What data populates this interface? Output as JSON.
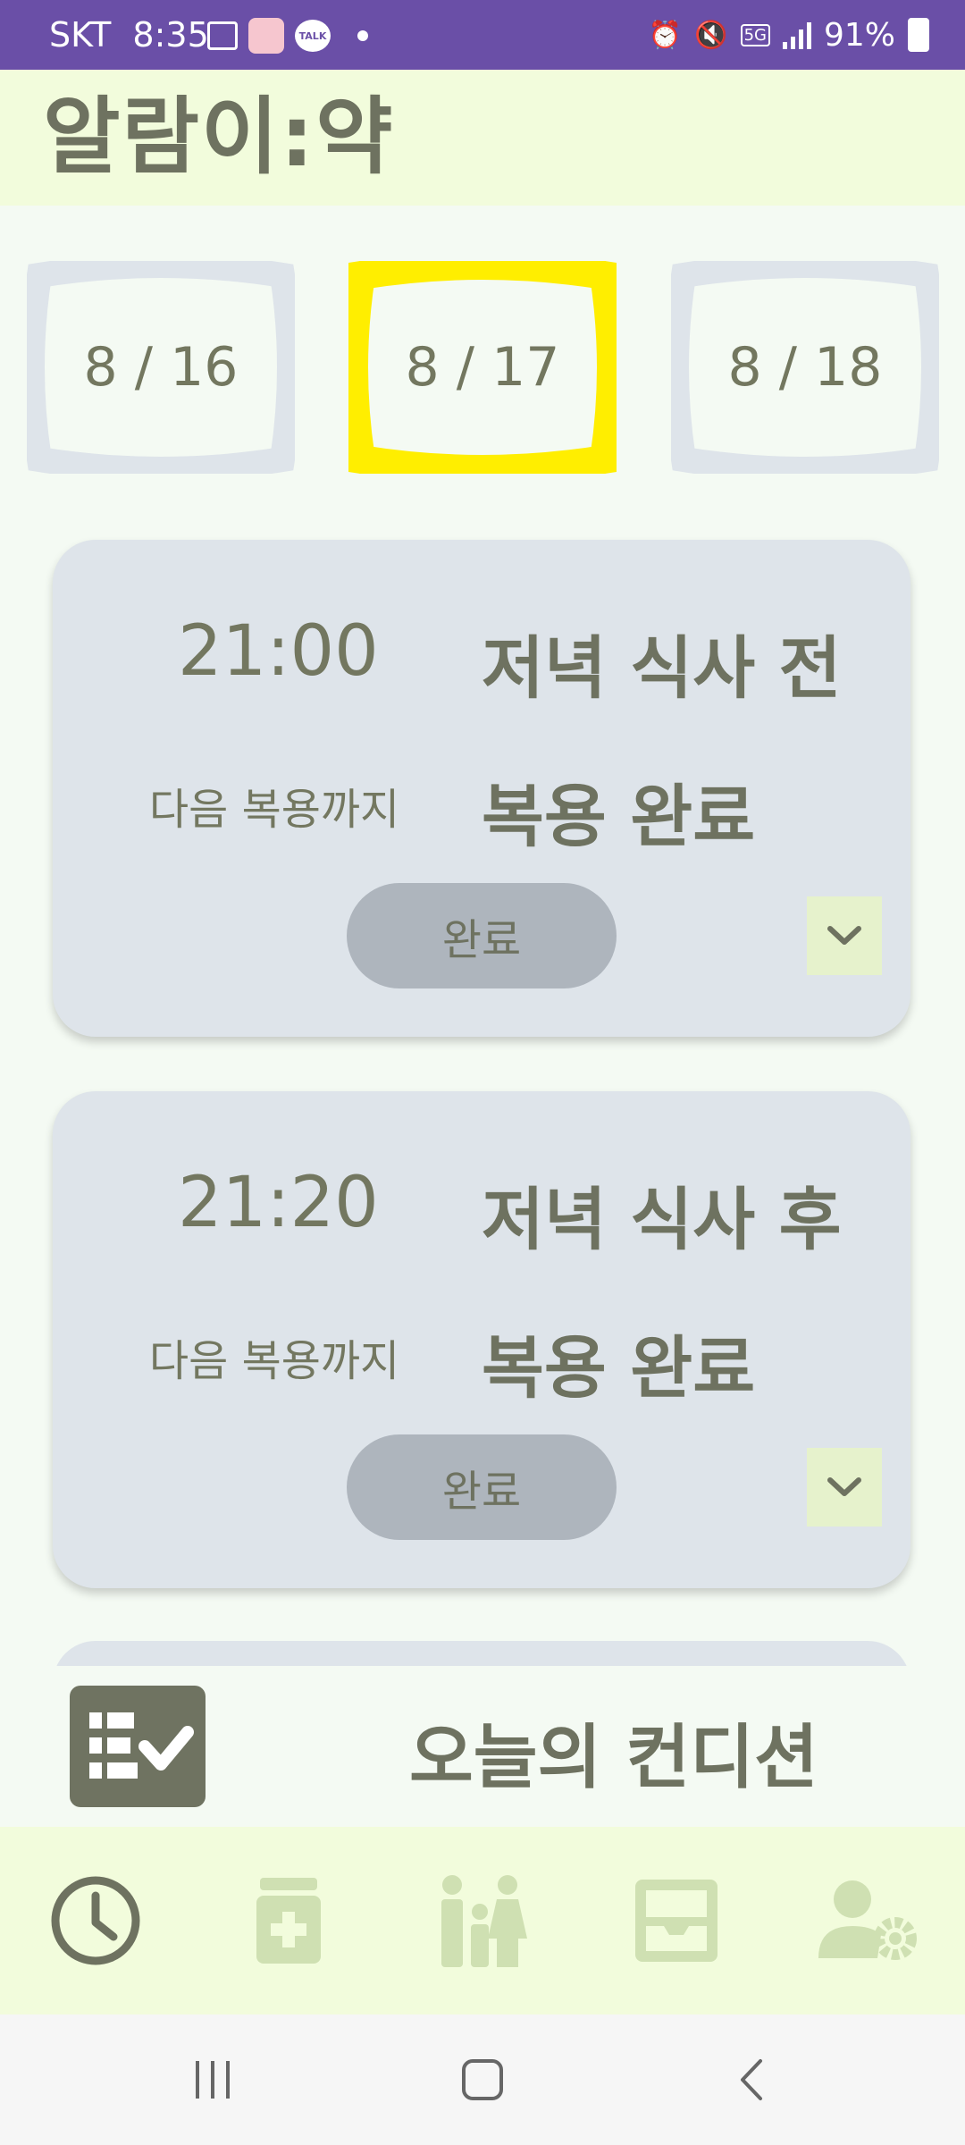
{
  "status_bar": {
    "carrier": "SKT",
    "time": "8:35",
    "battery": "91%",
    "network": "5G",
    "talk_badge": "TALK"
  },
  "app": {
    "title": "알람이:약"
  },
  "dates": [
    {
      "label": "8 / 16",
      "selected": false
    },
    {
      "label": "8 / 17",
      "selected": true
    },
    {
      "label": "8 / 18",
      "selected": false
    }
  ],
  "colors": {
    "selected_date": "#ffee00",
    "unselected_date": "#dee4ea",
    "accent_text": "#6e7260",
    "status_bar": "#6a4fa7"
  },
  "cards": [
    {
      "time": "21:00",
      "label": "저녁 식사 전",
      "next_label": "다음 복용까지",
      "status": "복용 완료",
      "button": "완료"
    },
    {
      "time": "21:20",
      "label": "저녁 식사 후",
      "next_label": "다음 복용까지",
      "status": "복용 완료",
      "button": "완료"
    }
  ],
  "condition": {
    "label": "오늘의 컨디션"
  },
  "bottom_nav": [
    {
      "icon": "clock-icon",
      "active": true
    },
    {
      "icon": "medicine-icon",
      "active": false
    },
    {
      "icon": "family-icon",
      "active": false
    },
    {
      "icon": "inbox-icon",
      "active": false
    },
    {
      "icon": "user-settings-icon",
      "active": false
    }
  ]
}
